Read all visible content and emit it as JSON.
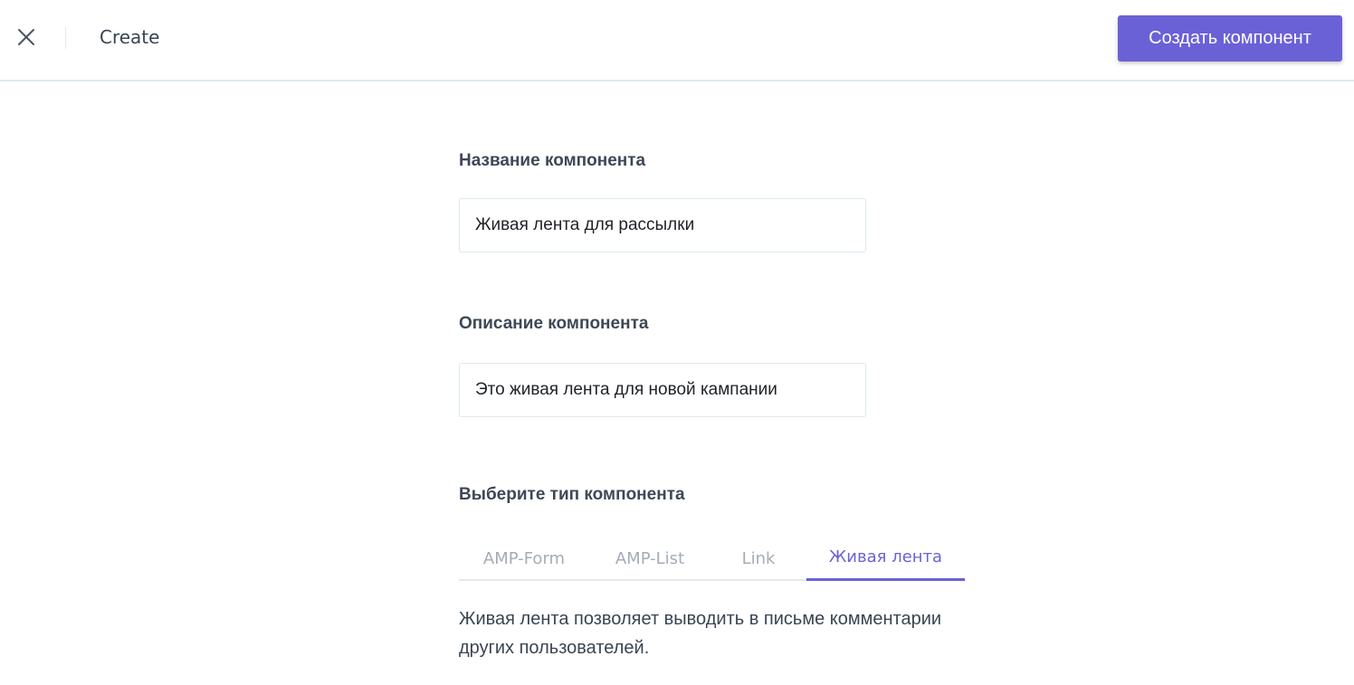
{
  "header": {
    "title": "Create",
    "create_button_label": "Создать компонент",
    "close_icon": "close-icon",
    "accent_color": "#6b61d6"
  },
  "form": {
    "name_label": "Название компонента",
    "name_value": "Живая лента для рассылки",
    "description_label": "Описание компонента",
    "description_value": "Это живая лента для новой кампании",
    "type_label": "Выберите тип компонента",
    "tabs": [
      {
        "label": "AMP-Form",
        "active": false
      },
      {
        "label": "AMP-List",
        "active": false
      },
      {
        "label": "Link",
        "active": false
      },
      {
        "label": "Живая лента",
        "active": true
      }
    ],
    "type_description": "Живая лента позволяет выводить в письме комментарии других пользователей."
  }
}
